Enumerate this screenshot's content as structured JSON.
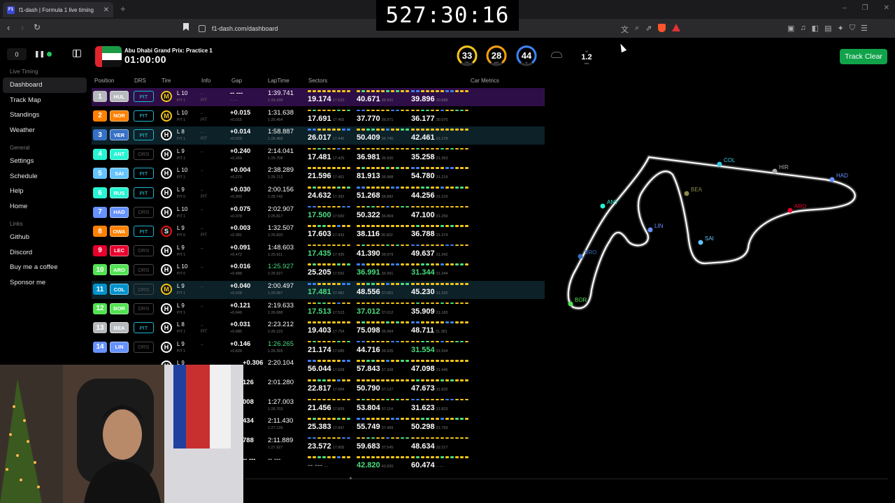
{
  "browser": {
    "tab_title": "f1-dash | Formula 1 live timing",
    "tab_favicon": "F1",
    "url": "f1-dash.com/dashboard"
  },
  "stream_timer": "527:30:16",
  "header": {
    "counter": "0",
    "session_name": "Abu Dhabi Grand Prix: Practice 1",
    "session_time": "01:00:00",
    "weather": [
      {
        "value": "33",
        "label": "TRC",
        "color": "#f5c518"
      },
      {
        "value": "28",
        "label": "AIR",
        "color": "#f59e0b"
      },
      {
        "value": "44",
        "label": "H",
        "color": "#3b82f6"
      }
    ],
    "wind_top": "W",
    "wind_speed": "1.2",
    "wind_unit": "m/s",
    "track_status": "Track Clear"
  },
  "sidebar": {
    "sections": [
      {
        "title": "Live Timing",
        "items": [
          "Dashboard",
          "Track Map",
          "Standings",
          "Weather"
        ]
      },
      {
        "title": "General",
        "items": [
          "Settings",
          "Schedule",
          "Help",
          "Home"
        ]
      },
      {
        "title": "Links",
        "items": [
          "Github",
          "Discord",
          "Buy me a coffee",
          "Sponsor me"
        ]
      }
    ],
    "active": "Dashboard"
  },
  "table_headers": [
    "Position",
    "DRS",
    "Tire",
    "Info",
    "Gap",
    "LapTime",
    "Sectors",
    "Car Metrics"
  ],
  "drivers": [
    {
      "pos": "1",
      "tla": "HUL",
      "color": "#b6babd",
      "drs": "PIT",
      "tire": "M",
      "lap": "L 10",
      "pits": "PIT 1",
      "info": "–",
      "info2": "PIT",
      "gap": "-- ---",
      "gap2": "-- ---",
      "lt": "1:39.741",
      "lt2": "1:25.439",
      "s": [
        [
          "19.174",
          "17.620"
        ],
        [
          "40.671",
          "36.931"
        ],
        [
          "39.896",
          "30.888"
        ]
      ],
      "hl": "purple"
    },
    {
      "pos": "2",
      "tla": "NOR",
      "color": "#ff8000",
      "drs": "PIT",
      "tire": "M",
      "lap": "L 10",
      "pits": "PIT 1",
      "info": "–",
      "info2": "PIT",
      "gap": "+0.015",
      "gap2": "+0.015",
      "lt": "1:31.638",
      "lt2": "1:25.454",
      "s": [
        [
          "17.691",
          "17.465"
        ],
        [
          "37.770",
          "36.971"
        ],
        [
          "36.177",
          "30.975"
        ]
      ]
    },
    {
      "pos": "3",
      "tla": "VER",
      "color": "#3671c6",
      "drs": "PIT",
      "tire": "H",
      "lap": "L 8",
      "pits": "PIT 1",
      "info": "–",
      "info2": "PIT",
      "gap": "+0.014",
      "gap2": "+0.029",
      "lt": "1:58.887",
      "lt2": "1:25.468",
      "s": [
        [
          "26.017",
          "17.445"
        ],
        [
          "50.409",
          "36.745"
        ],
        [
          "42.461",
          "31.278"
        ]
      ],
      "hl": "teal"
    },
    {
      "pos": "4",
      "tla": "ANT",
      "color": "#27f4d2",
      "drs": "DRS",
      "tire": "H",
      "lap": "L 9",
      "pits": "PIT 1",
      "info": "–",
      "info2": "",
      "gap": "+0.240",
      "gap2": "+0.269",
      "lt": "2:14.041",
      "lt2": "1:25.708",
      "s": [
        [
          "17.481",
          "17.425"
        ],
        [
          "36.981",
          "36.930"
        ],
        [
          "35.258",
          "31.353"
        ]
      ]
    },
    {
      "pos": "5",
      "tla": "SAI",
      "color": "#64c4ff",
      "drs": "PIT",
      "tire": "H",
      "lap": "L 10",
      "pits": "PIT 1",
      "info": "–",
      "info2": "",
      "gap": "+0.004",
      "gap2": "+0.273",
      "lt": "2:38.289",
      "lt2": "1:25.712",
      "s": [
        [
          "21.596",
          "17.451"
        ],
        [
          "81.913",
          "36.988"
        ],
        [
          "54.780",
          "31.219"
        ]
      ]
    },
    {
      "pos": "6",
      "tla": "RUS",
      "color": "#27f4d2",
      "drs": "PIT",
      "tire": "H",
      "lap": "L 9",
      "pits": "PIT 0",
      "info": "–",
      "info2": "PIT",
      "gap": "+0.030",
      "gap2": "+0.303",
      "lt": "2:00.156",
      "lt2": "1:25.742",
      "s": [
        [
          "24.632",
          "17.392"
        ],
        [
          "51.268",
          "36.882"
        ],
        [
          "44.256",
          "31.219"
        ]
      ]
    },
    {
      "pos": "7",
      "tla": "HAD",
      "color": "#6692ff",
      "drs": "DRS",
      "tire": "H",
      "lap": "L 10",
      "pits": "PIT 1",
      "info": "–",
      "info2": "",
      "gap": "+0.075",
      "gap2": "+0.378",
      "lt": "2:02.907",
      "lt2": "1:25.817",
      "s": [
        [
          "17.500",
          "17.500"
        ],
        [
          "50.322",
          "36.894"
        ],
        [
          "47.100",
          "31.259"
        ]
      ]
    },
    {
      "pos": "8",
      "tla": "OWA",
      "color": "#ff8000",
      "drs": "PIT",
      "tire": "S",
      "lap": "L 9",
      "pits": "PIT 0",
      "info": "–",
      "info2": "PIT",
      "gap": "+0.003",
      "gap2": "+0.381",
      "lt": "1:32.507",
      "lt2": "1:25.820",
      "s": [
        [
          "17.603",
          "17.433"
        ],
        [
          "38.116",
          "36.822"
        ],
        [
          "36.788",
          "31.374"
        ]
      ]
    },
    {
      "pos": "9",
      "tla": "LEC",
      "color": "#e8002d",
      "drs": "DRS",
      "tire": "H",
      "lap": "L 9",
      "pits": "PIT 1",
      "info": "–",
      "info2": "",
      "gap": "+0.091",
      "gap2": "+0.472",
      "lt": "1:48.603",
      "lt2": "1:25.911",
      "s": [
        [
          "17.435",
          "17.435"
        ],
        [
          "41.390",
          "36.979"
        ],
        [
          "49.637",
          "31.342"
        ]
      ]
    },
    {
      "pos": "10",
      "tla": "ARO",
      "color": "#52e252",
      "drs": "DRS",
      "tire": "H",
      "lap": "L 10",
      "pits": "PIT 0",
      "info": "–",
      "info2": "",
      "gap": "+0.016",
      "gap2": "+0.488",
      "lt": "1:25.927",
      "lt2": "1:25.927",
      "lt_green": true,
      "s": [
        [
          "25.205",
          "17.592"
        ],
        [
          "36.991",
          "36.991"
        ],
        [
          "31.344",
          "31.344"
        ]
      ]
    },
    {
      "pos": "11",
      "tla": "COL",
      "color": "#0093cc",
      "drs": "DRS",
      "tire": "M",
      "lap": "L 9",
      "pits": "PIT 1",
      "info": "–",
      "info2": "",
      "gap": "+0.040",
      "gap2": "+0.528",
      "lt": "2:00.497",
      "lt2": "1:25.967",
      "s": [
        [
          "17.481",
          "17.481"
        ],
        [
          "48.556",
          "37.061"
        ],
        [
          "45.230",
          "31.332"
        ]
      ],
      "hl": "teal"
    },
    {
      "pos": "12",
      "tla": "BOR",
      "color": "#52e252",
      "drs": "DRS",
      "tire": "H",
      "lap": "L 9",
      "pits": "PIT 1",
      "info": "–",
      "info2": "",
      "gap": "+0.121",
      "gap2": "+0.649",
      "lt": "2:19.633",
      "lt2": "1:26.088",
      "s": [
        [
          "17.513",
          "17.513"
        ],
        [
          "37.012",
          "37.012"
        ],
        [
          "35.909",
          "31.183"
        ]
      ]
    },
    {
      "pos": "13",
      "tla": "BEA",
      "color": "#b6babd",
      "drs": "PIT",
      "tire": "H",
      "lap": "L 8",
      "pits": "PIT 1",
      "info": "–",
      "info2": "PIT",
      "gap": "+0.031",
      "gap2": "+0.680",
      "lt": "2:23.212",
      "lt2": "1:26.119",
      "s": [
        [
          "19.403",
          "17.754"
        ],
        [
          "75.098",
          "36.984"
        ],
        [
          "48.711",
          "31.381"
        ]
      ]
    },
    {
      "pos": "14",
      "tla": "LIN",
      "color": "#6692ff",
      "drs": "DRS",
      "tire": "H",
      "lap": "L 9",
      "pits": "PIT 1",
      "info": "–",
      "info2": "",
      "gap": "+0.146",
      "gap2": "+0.826",
      "lt": "1:26.265",
      "lt2": "1:26.265",
      "lt_green": true,
      "s": [
        [
          "21.174",
          "17.685"
        ],
        [
          "44.716",
          "36.935"
        ],
        [
          "31.554",
          "31.554"
        ]
      ]
    },
    {
      "pos": "",
      "tla": "",
      "color": "#888888",
      "drs": "",
      "tire": "H",
      "lap": "L 9",
      "pits": "",
      "info": "",
      "info2": "",
      "gap": "+0.306",
      "gap2": "",
      "lt": "2:20.104",
      "lt2": "",
      "s": [
        [
          "56.044",
          "17.608"
        ],
        [
          "57.843",
          "37.308"
        ],
        [
          "47.098",
          "31.446"
        ]
      ]
    },
    {
      "pos": "",
      "tla": "",
      "color": "#888888",
      "drs": "",
      "tire": "",
      "lap": "",
      "pits": "",
      "info": "",
      "info2": "",
      "gap": "126",
      "gap2": "",
      "lt": "2:01.280",
      "lt2": "",
      "s": [
        [
          "22.817",
          "17.684"
        ],
        [
          "50.790",
          "37.127"
        ],
        [
          "47.673",
          "31.820"
        ]
      ]
    },
    {
      "pos": "",
      "tla": "",
      "color": "#888888",
      "drs": "",
      "tire": "",
      "lap": "",
      "pits": "",
      "info": "",
      "info2": "",
      "gap": "008",
      "gap2": "",
      "lt": "1:27.003",
      "lt2": "1:26.703",
      "s": [
        [
          "21.456",
          "17.835"
        ],
        [
          "53.804",
          "37.114"
        ],
        [
          "31.623",
          "31.823"
        ]
      ]
    },
    {
      "pos": "",
      "tla": "",
      "color": "#888888",
      "drs": "",
      "tire": "",
      "lap": "",
      "pits": "",
      "info": "",
      "info2": "",
      "gap": "434",
      "gap2": "",
      "lt": "2:11.430",
      "lt2": "1:27.139",
      "s": [
        [
          "25.383",
          "17.847"
        ],
        [
          "55.749",
          "37.499"
        ],
        [
          "50.298",
          "31.793"
        ]
      ]
    },
    {
      "pos": "",
      "tla": "",
      "color": "#888888",
      "drs": "",
      "tire": "",
      "lap": "",
      "pits": "",
      "info": "",
      "info2": "",
      "gap": "788",
      "gap2": "",
      "lt": "2:11.889",
      "lt2": "1:27.927",
      "s": [
        [
          "23.572",
          "17.905"
        ],
        [
          "59.683",
          "37.545"
        ],
        [
          "48.634",
          "32.217"
        ]
      ]
    },
    {
      "pos": "",
      "tla": "",
      "color": "#888888",
      "drs": "",
      "tire": "",
      "lap": "",
      "pits": "",
      "info": "",
      "info2": "",
      "gap": "-- ---",
      "gap2": "",
      "lt": "-- ---",
      "lt2": "",
      "s": [
        [
          "-- ---",
          "---"
        ],
        [
          "42.820",
          "42.820"
        ],
        [
          "60.474",
          "-- ---"
        ]
      ]
    }
  ],
  "track_labels": [
    {
      "name": "COL",
      "color": "#36c9e3"
    },
    {
      "name": "HIR",
      "color": "#aaaaaa"
    },
    {
      "name": "HAD",
      "color": "#6692ff"
    },
    {
      "name": "ARO",
      "color": "#e8002d"
    },
    {
      "name": "BEA",
      "color": "#8a8a4a"
    },
    {
      "name": "ANT",
      "color": "#27f4d2"
    },
    {
      "name": "LIN",
      "color": "#6692ff"
    },
    {
      "name": "SAI",
      "color": "#64c4ff"
    },
    {
      "name": "BRO",
      "color": "#3671c6"
    },
    {
      "name": "BOR",
      "color": "#52e252"
    }
  ]
}
